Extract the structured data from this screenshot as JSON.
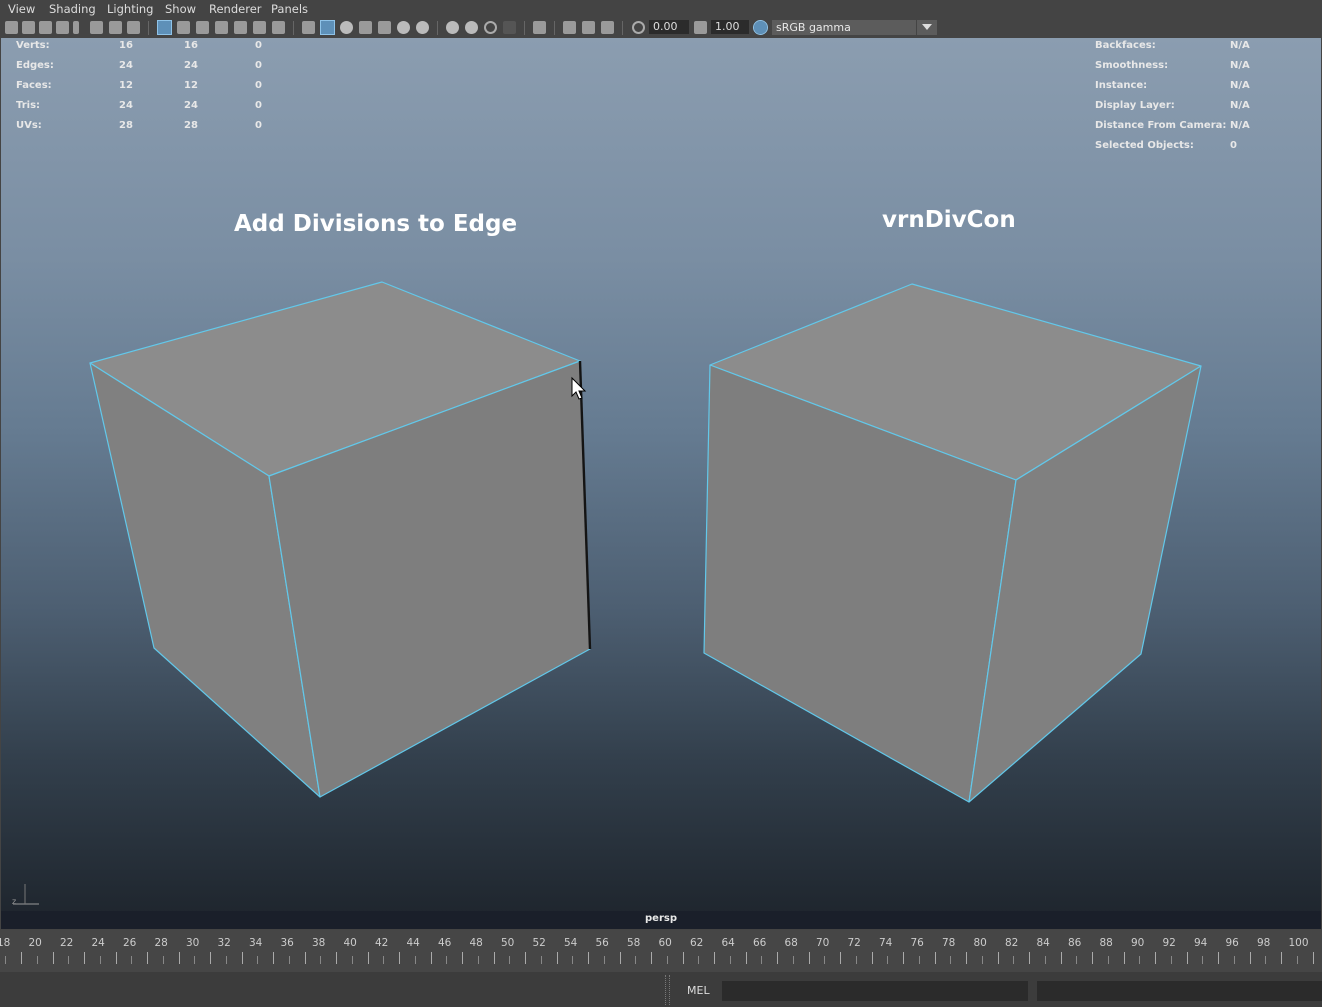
{
  "menu": [
    "View",
    "Shading",
    "Lighting",
    "Show",
    "Renderer",
    "Panels"
  ],
  "toolbar": {
    "exposure": "0.00",
    "gamma": "1.00",
    "color_space": "sRGB gamma"
  },
  "hud_left": [
    {
      "label": "Verts:",
      "a": "16",
      "b": "16",
      "c": "0"
    },
    {
      "label": "Edges:",
      "a": "24",
      "b": "24",
      "c": "0"
    },
    {
      "label": "Faces:",
      "a": "12",
      "b": "12",
      "c": "0"
    },
    {
      "label": "Tris:",
      "a": "24",
      "b": "24",
      "c": "0"
    },
    {
      "label": "UVs:",
      "a": "28",
      "b": "28",
      "c": "0"
    }
  ],
  "hud_right": [
    {
      "label": "Backfaces:",
      "value": "N/A"
    },
    {
      "label": "Smoothness:",
      "value": "N/A"
    },
    {
      "label": "Instance:",
      "value": "N/A"
    },
    {
      "label": "Display Layer:",
      "value": "N/A"
    },
    {
      "label": "Distance From Camera:",
      "value": "N/A"
    },
    {
      "label": "Selected Objects:",
      "value": "0"
    }
  ],
  "headings": {
    "left": "Add Divisions to Edge",
    "right": "vrnDivCon"
  },
  "camera": "persp",
  "timeline": {
    "labels": [
      "18",
      "20",
      "22",
      "24",
      "26",
      "28",
      "30",
      "32",
      "34",
      "36",
      "38",
      "40",
      "42",
      "44",
      "46",
      "48",
      "50",
      "52",
      "54",
      "56",
      "58",
      "60",
      "62",
      "64",
      "66",
      "68",
      "70",
      "72",
      "74",
      "76",
      "78",
      "80",
      "82",
      "84",
      "86",
      "88",
      "90",
      "92",
      "94",
      "96",
      "98",
      "100"
    ]
  },
  "cmd": {
    "lang": "MEL"
  },
  "colors": {
    "wire": "#62c8ea",
    "face_top": "#8c8c8c",
    "face_side": "#7e7e7e",
    "selected_edge": "#141414"
  }
}
